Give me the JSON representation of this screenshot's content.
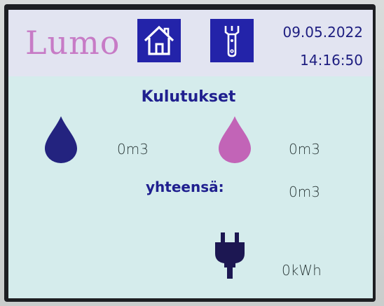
{
  "header": {
    "logo": "Lumo",
    "home_icon": "home-icon",
    "tools_icon": "wrench-icon",
    "date": "09.05.2022",
    "time": "14:16:50"
  },
  "consumption": {
    "title": "Kulutukset",
    "cold_water": {
      "icon": "water-drop-icon",
      "color": "#23237f",
      "value": "0m3"
    },
    "hot_water": {
      "icon": "water-drop-icon",
      "color": "#c264b7",
      "value": "0m3"
    },
    "total": {
      "label": "yhteensä:",
      "value": "0m3"
    },
    "electricity": {
      "icon": "power-plug-icon",
      "color": "#1c1752",
      "value": "0kWh"
    }
  },
  "colors": {
    "accent": "#2323a9",
    "title_text": "#20208f",
    "screen_bg": "#d5ecec",
    "header_bg": "#e2e4f1"
  }
}
